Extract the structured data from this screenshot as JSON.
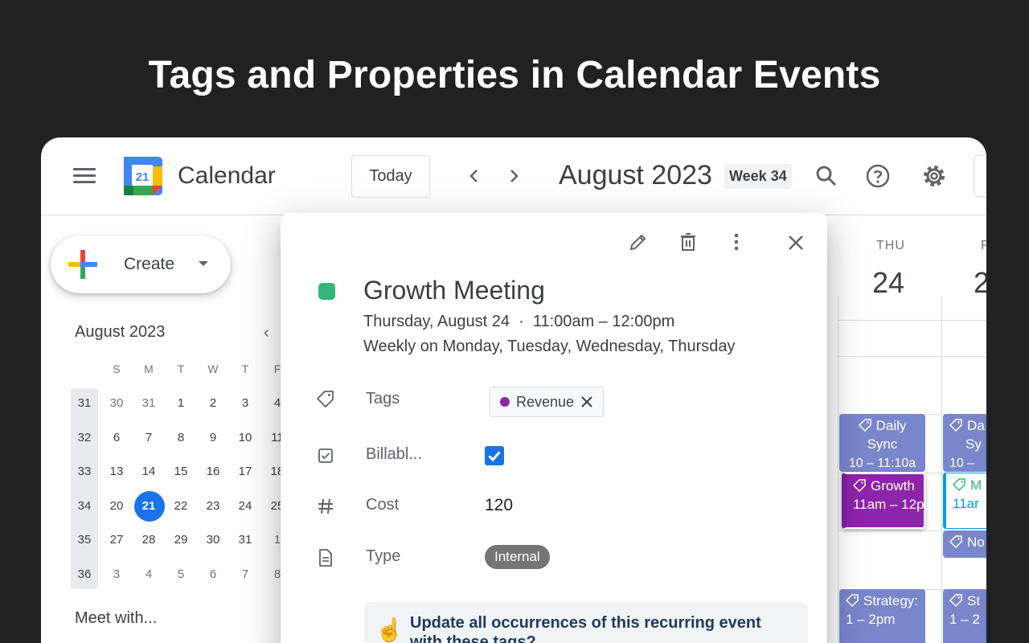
{
  "headline": "Tags and Properties in Calendar Events",
  "header": {
    "app_name": "Calendar",
    "logo_day": "21",
    "today_label": "Today",
    "month_title": "August 2023",
    "week_badge": "Week 34"
  },
  "sidebar": {
    "create_label": "Create",
    "mini_calendar": {
      "title": "August 2023",
      "prev_arrow": "‹",
      "weekdays": [
        "S",
        "M",
        "T",
        "W",
        "T",
        "F"
      ],
      "weeks": [
        {
          "wk": "31",
          "days": [
            "30",
            "31",
            "1",
            "2",
            "3",
            "4"
          ]
        },
        {
          "wk": "32",
          "days": [
            "6",
            "7",
            "8",
            "9",
            "10",
            "11"
          ]
        },
        {
          "wk": "33",
          "days": [
            "13",
            "14",
            "15",
            "16",
            "17",
            "18"
          ]
        },
        {
          "wk": "34",
          "days": [
            "20",
            "21",
            "22",
            "23",
            "24",
            "25"
          ]
        },
        {
          "wk": "35",
          "days": [
            "27",
            "28",
            "29",
            "30",
            "31",
            "1"
          ]
        },
        {
          "wk": "36",
          "days": [
            "3",
            "4",
            "5",
            "6",
            "7",
            "8"
          ]
        }
      ],
      "today": "21"
    },
    "meet_with": "Meet with..."
  },
  "week_view": {
    "day_label": "THU",
    "day_number": "24",
    "next_day_label": "F",
    "next_day_number": "2",
    "events": [
      {
        "title": "Daily",
        "title2": "Sync",
        "time": "10 – 11:10a",
        "color": "#7986cb"
      },
      {
        "title": "Da",
        "title2": "Sy",
        "time": "10 –",
        "color": "#7986cb"
      },
      {
        "title": "Growth",
        "time": "11am – 12p",
        "color": "#8e24aa"
      },
      {
        "title": "M",
        "time": "11ar",
        "color": "#039be5"
      },
      {
        "title": "No",
        "color": "#7986cb"
      },
      {
        "title": "Strategy:",
        "time": "1 – 2pm",
        "color": "#7986cb"
      },
      {
        "title": "St",
        "time": "1 – 2",
        "color": "#7986cb"
      }
    ]
  },
  "popup": {
    "title": "Growth Meeting",
    "when": "Thursday, August 24  ·  11:00am – 12:00pm",
    "recurrence": "Weekly on Monday, Tuesday, Wednesday, Thursday",
    "event_color": "#33b679",
    "props": {
      "tags_label": "Tags",
      "tag_value": "Revenue",
      "tag_color": "#8e24aa",
      "billable_label": "Billabl...",
      "billable_checked": true,
      "cost_label": "Cost",
      "cost_value": "120",
      "type_label": "Type",
      "type_value": "Internal"
    },
    "notice_emoji": "☝️",
    "notice": "Update all occurrences of this recurring event with these tags?"
  }
}
